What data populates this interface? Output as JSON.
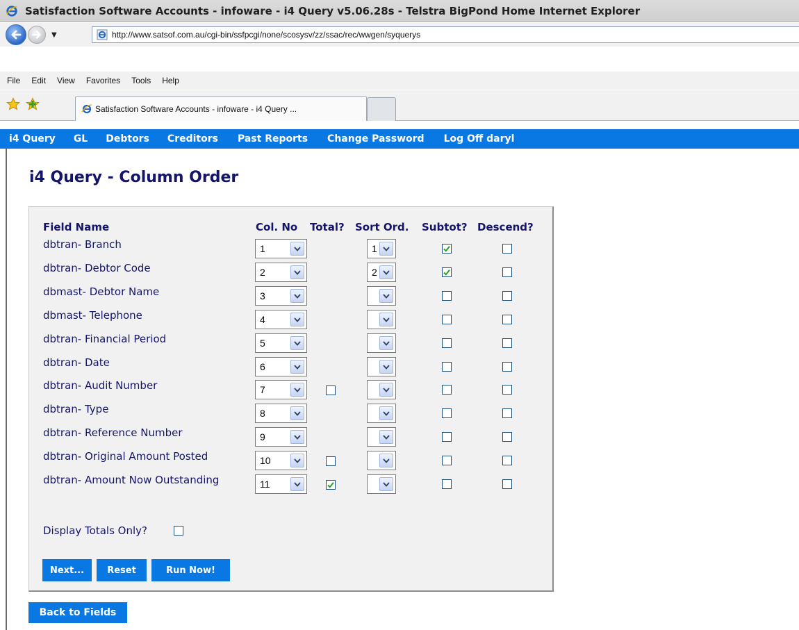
{
  "window": {
    "title": "Satisfaction Software Accounts - infoware - i4 Query v5.06.28s - Telstra BigPond Home Internet Explorer"
  },
  "browser": {
    "url": "http://www.satsof.com.au/cgi-bin/ssfpcgi/none/scosysv/zz/ssac/rec/wwgen/syquerys",
    "menu": [
      "File",
      "Edit",
      "View",
      "Favorites",
      "Tools",
      "Help"
    ],
    "tab_label": "Satisfaction Software Accounts - infoware - i4 Query ..."
  },
  "site_nav": [
    "i4 Query",
    "GL",
    "Debtors",
    "Creditors",
    "Past Reports",
    "Change Password",
    "Log Off daryl"
  ],
  "page_title": "i4 Query - Column Order",
  "table": {
    "headers": {
      "field_name": "Field Name",
      "col_no": "Col. No",
      "total": "Total?",
      "sort_ord": "Sort Ord.",
      "subtot": "Subtot?",
      "descend": "Descend?"
    },
    "rows": [
      {
        "field": "dbtran- Branch",
        "col": "1",
        "has_total": false,
        "total": false,
        "sort": "1",
        "subtot": true,
        "descend": false
      },
      {
        "field": "dbtran- Debtor Code",
        "col": "2",
        "has_total": false,
        "total": false,
        "sort": "2",
        "subtot": true,
        "descend": false
      },
      {
        "field": "dbmast- Debtor Name",
        "col": "3",
        "has_total": false,
        "total": false,
        "sort": "",
        "subtot": false,
        "descend": false
      },
      {
        "field": "dbmast- Telephone",
        "col": "4",
        "has_total": false,
        "total": false,
        "sort": "",
        "subtot": false,
        "descend": false
      },
      {
        "field": "dbtran- Financial Period",
        "col": "5",
        "has_total": false,
        "total": false,
        "sort": "",
        "subtot": false,
        "descend": false
      },
      {
        "field": "dbtran- Date",
        "col": "6",
        "has_total": false,
        "total": false,
        "sort": "",
        "subtot": false,
        "descend": false
      },
      {
        "field": "dbtran- Audit Number",
        "col": "7",
        "has_total": true,
        "total": false,
        "sort": "",
        "subtot": false,
        "descend": false
      },
      {
        "field": "dbtran- Type",
        "col": "8",
        "has_total": false,
        "total": false,
        "sort": "",
        "subtot": false,
        "descend": false
      },
      {
        "field": "dbtran- Reference Number",
        "col": "9",
        "has_total": false,
        "total": false,
        "sort": "",
        "subtot": false,
        "descend": false
      },
      {
        "field": "dbtran- Original Amount Posted",
        "col": "10",
        "has_total": true,
        "total": false,
        "sort": "",
        "subtot": false,
        "descend": false
      },
      {
        "field": "dbtran- Amount Now Outstanding",
        "col": "11",
        "has_total": true,
        "total": true,
        "sort": "",
        "subtot": false,
        "descend": false
      }
    ]
  },
  "display_totals_only": {
    "label": "Display Totals Only?",
    "checked": false
  },
  "buttons": {
    "next": "Next...",
    "reset": "Reset",
    "run_now": "Run Now!"
  },
  "back_link": "Back to Fields",
  "colors": {
    "nav_blue": "#0a78e2",
    "heading_navy": "#14146b",
    "check_green": "#21a121"
  }
}
